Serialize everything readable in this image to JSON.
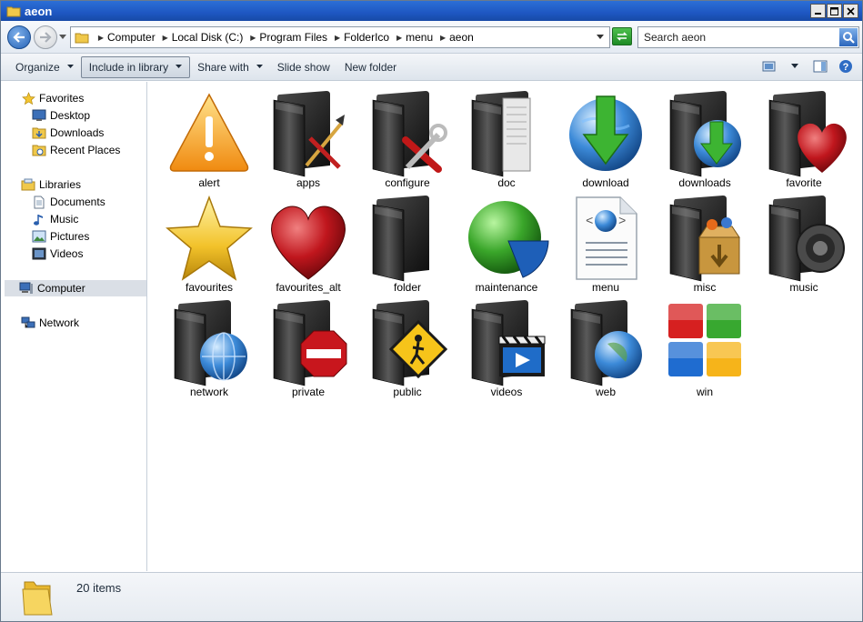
{
  "window": {
    "title": "aeon"
  },
  "address": {
    "crumbs": [
      "Computer",
      "Local Disk (C:)",
      "Program Files",
      "FolderIco",
      "menu",
      "aeon"
    ],
    "search_placeholder": "Search aeon"
  },
  "toolbar": {
    "organize": "Organize",
    "include_in_library": "Include in library",
    "share_with": "Share with",
    "slide_show": "Slide show",
    "new_folder": "New folder"
  },
  "nav": {
    "favorites": "Favorites",
    "desktop": "Desktop",
    "downloads": "Downloads",
    "recent_places": "Recent Places",
    "libraries": "Libraries",
    "documents": "Documents",
    "music": "Music",
    "pictures": "Pictures",
    "videos": "Videos",
    "computer": "Computer",
    "network": "Network"
  },
  "files": [
    {
      "label": "alert",
      "icon": "alert-icon"
    },
    {
      "label": "apps",
      "icon": "apps-folder-icon"
    },
    {
      "label": "configure",
      "icon": "configure-folder-icon"
    },
    {
      "label": "doc",
      "icon": "doc-folder-icon"
    },
    {
      "label": "download",
      "icon": "download-globe-icon"
    },
    {
      "label": "downloads",
      "icon": "downloads-folder-icon"
    },
    {
      "label": "favorite",
      "icon": "favorite-folder-icon"
    },
    {
      "label": "favourites",
      "icon": "star-icon"
    },
    {
      "label": "favourites_alt",
      "icon": "heart-icon"
    },
    {
      "label": "folder",
      "icon": "folder-icon"
    },
    {
      "label": "maintenance",
      "icon": "pie-chart-icon"
    },
    {
      "label": "menu",
      "icon": "menu-document-icon"
    },
    {
      "label": "misc",
      "icon": "misc-folder-icon"
    },
    {
      "label": "music",
      "icon": "music-folder-icon"
    },
    {
      "label": "network",
      "icon": "network-folder-icon"
    },
    {
      "label": "private",
      "icon": "private-folder-icon"
    },
    {
      "label": "public",
      "icon": "public-folder-icon"
    },
    {
      "label": "videos",
      "icon": "videos-folder-icon"
    },
    {
      "label": "web",
      "icon": "web-folder-icon"
    },
    {
      "label": "win",
      "icon": "windows-logo-icon"
    }
  ],
  "status": {
    "item_count": "20 items"
  },
  "colors": {
    "titlebar": "#1e57c2",
    "selection": "#dadfe6"
  }
}
